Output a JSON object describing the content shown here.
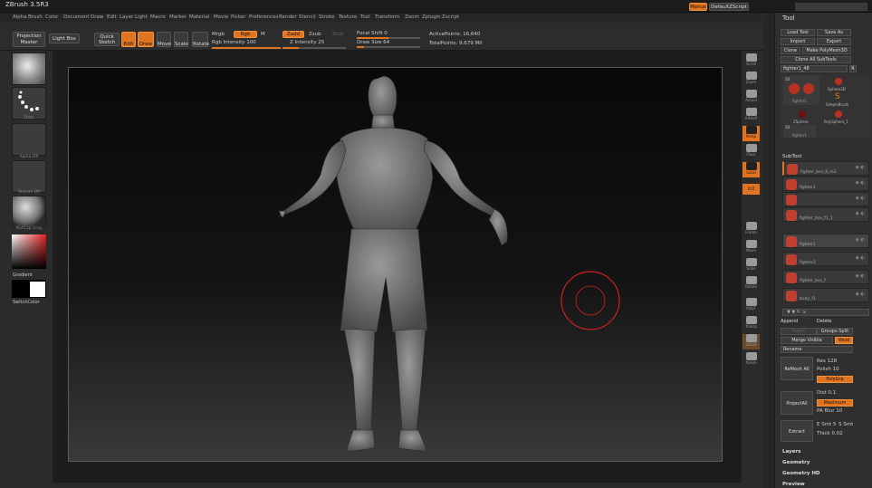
{
  "app_title": "ZBrush 3.5R3",
  "title_controls": [
    "Menus",
    "DefaultZScript"
  ],
  "menus": [
    "Alpha",
    "Brush",
    "Color",
    "Document",
    "Draw",
    "Edit",
    "Layer",
    "Light",
    "Macro",
    "Marker",
    "Material",
    "Movie",
    "Picker",
    "Preferences",
    "Render",
    "Stencil",
    "Stroke",
    "Texture",
    "Tool",
    "Transform",
    "Zoom",
    "Zplugin",
    "Zscript"
  ],
  "topbar": {
    "projection_master": "Projection Master",
    "light_box": "Light Box",
    "quick_sketch": "Quick Sketch",
    "edit": "Edit",
    "draw": "Draw",
    "move": "Move",
    "scale": "Scale",
    "rotate": "Rotate",
    "mrgb": "Mrgb",
    "rgb": "Rgb",
    "m": "M",
    "rgb_intensity": "Rgb Intensity 100",
    "zadd": "Zadd",
    "zsub": "Zsub",
    "zcut": "Zcut",
    "z_intensity": "Z Intensity 25",
    "focal_shift": "Focal Shift 0",
    "draw_size": "Draw Size 64",
    "active_points": "ActivePoints: 16,640",
    "total_points": "TotalPoints: 9.679 Mil"
  },
  "left_shelf": {
    "brush_label": "Standard",
    "stroke_label": "Dots",
    "alpha_label": "Alpha Off",
    "texture_label": "Texture Off",
    "material_label": "MatCap Gray",
    "gradient_label": "Gradient",
    "switch_label": "SwitchColor"
  },
  "right_shelf": [
    "Scroll",
    "Zoom",
    "Actual",
    "AAHalf",
    "Persp",
    "Floor",
    "Local",
    "XYZ",
    "Frame",
    "Move",
    "Scale",
    "Rotate",
    "PolyF",
    "Transp",
    "Ghost",
    "Xpose"
  ],
  "tool_panel": {
    "title": "Tool",
    "load_tool": "Load Tool",
    "save_as": "Save As",
    "import": "Import",
    "export": "Export",
    "clone": "Clone",
    "make_polymesh": "Make PolyMesh3D",
    "clone_all": "Clone All SubTools",
    "current_tool": "fighter1_48",
    "tool_count": "R",
    "thumbs": [
      "fighter1",
      "Sphere3D",
      "SimpleBrush",
      "ZSphere",
      "PolySphere_1",
      "fighter1"
    ],
    "thumb_counts": [
      "10",
      "10"
    ],
    "subtool_header": "SubTool",
    "subtools": [
      "fighter_bsv_8_re2",
      "fighter1",
      "",
      "fighter_bsv_f1_1",
      "fighter1",
      "fighter2",
      "fighter_bsv_f",
      "body_f1"
    ],
    "append": "Append",
    "delete": "Delete",
    "insert": "Insert",
    "groups_split": "Groups Split",
    "merge_visible": "Merge Visible",
    "weld": "Weld",
    "rename": "Rename",
    "remesh_all": "ReMesh All",
    "res": "Res 128",
    "polish": "Polish 10",
    "polygrp": "PolyGrp",
    "project_all": "ProjectAll",
    "dist": "Dist 0.1",
    "maximum": "Maximum",
    "pa_blur": "PA Blur 10",
    "extract": "Extract",
    "e_smt": "E Smt 5",
    "s_smt": "S Smt",
    "thick": "Thick 0.02",
    "layers": "Layers",
    "geometry": "Geometry",
    "geometry_hd": "Geometry HD",
    "preview": "Preview"
  },
  "colors": {
    "accent": "#e07420",
    "brush_cursor": "#d02020"
  }
}
